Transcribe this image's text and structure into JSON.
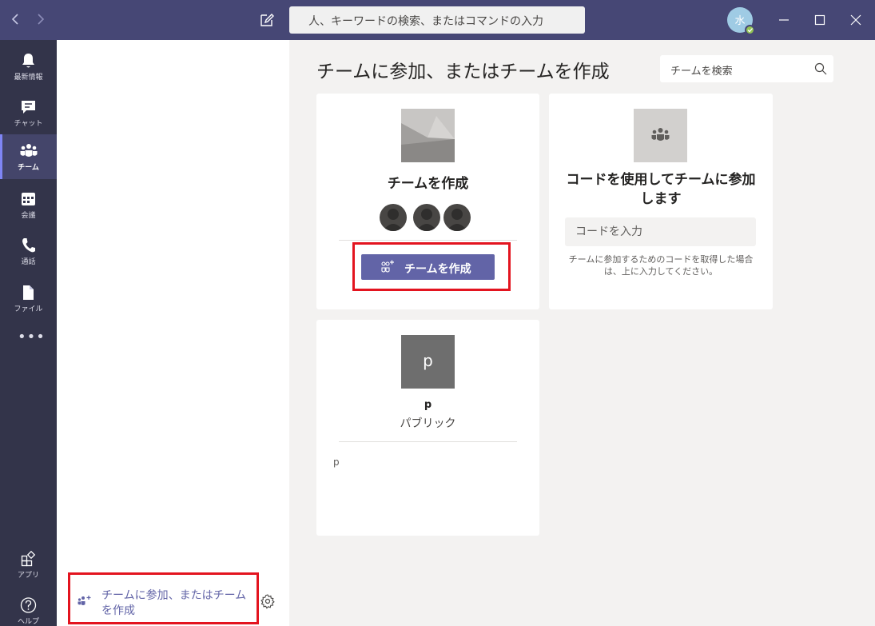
{
  "app": {
    "search_placeholder": "人、キーワードの検索、またはコマンドの入力",
    "avatar_initial": "水",
    "accent_color": "#6264a7",
    "titlebar_color": "#464775"
  },
  "rail": {
    "items": [
      {
        "label": "最新情報",
        "icon": "bell-icon"
      },
      {
        "label": "チャット",
        "icon": "chat-icon"
      },
      {
        "label": "チーム",
        "icon": "teams-icon"
      },
      {
        "label": "会議",
        "icon": "calendar-icon"
      },
      {
        "label": "通話",
        "icon": "phone-icon"
      },
      {
        "label": "ファイル",
        "icon": "file-icon"
      }
    ],
    "more": "•••",
    "apps_label": "アプリ",
    "help_label": "ヘルプ"
  },
  "sidebar": {
    "join_create_label": "チームに参加、またはチーム を作成"
  },
  "main": {
    "title": "チームに参加、またはチームを作成",
    "search_placeholder": "チームを検索",
    "create_card": {
      "title": "チームを作成",
      "button_label": "チームを作成"
    },
    "code_card": {
      "title": "コードを使用してチームに参加します",
      "input_placeholder": "コードを入力",
      "help_text": "チームに参加するためのコードを取得した場合は、上に入力してください。"
    },
    "team_card": {
      "thumb_letter": "p",
      "name": "p",
      "visibility": "パブリック",
      "description": "p"
    }
  }
}
